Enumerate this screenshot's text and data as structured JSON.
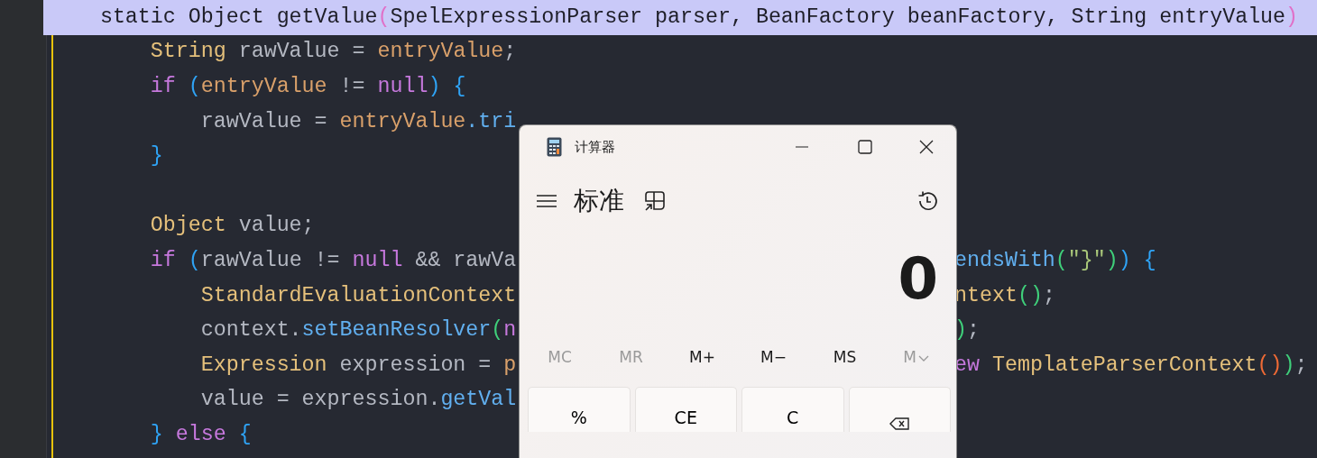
{
  "editor": {
    "signature": {
      "highlighted": true,
      "tokens": [
        {
          "text": "static Object getValue",
          "kind": "plain"
        },
        {
          "text": "(",
          "kind": "paren-pink"
        },
        {
          "text": "SpelExpressionParser parser, BeanFactory beanFactory, String entryValue",
          "kind": "plain"
        },
        {
          "text": ")",
          "kind": "paren-pink"
        }
      ]
    },
    "lines": [
      {
        "kind": "code",
        "highlighted": false,
        "tokens": [
          {
            "text": "String ",
            "kind": "type"
          },
          {
            "text": "rawValue = ",
            "kind": "plain"
          },
          {
            "text": "entryValue",
            "kind": "param"
          },
          {
            "text": ";",
            "kind": "plain"
          }
        ]
      },
      {
        "kind": "code",
        "highlighted": false,
        "tokens": [
          {
            "text": "if ",
            "kind": "keyword"
          },
          {
            "text": "(",
            "kind": "brace-blue"
          },
          {
            "text": "entryValue",
            "kind": "param"
          },
          {
            "text": " != ",
            "kind": "plain"
          },
          {
            "text": "null",
            "kind": "keyword"
          },
          {
            "text": ") {",
            "kind": "brace-blue"
          }
        ],
        "children": [
          {
            "kind": "code",
            "highlighted": false,
            "tokens": [
              {
                "text": "rawValue = ",
                "kind": "plain"
              },
              {
                "text": "entryValue",
                "kind": "param"
              },
              {
                "text": ".tri",
                "kind": "method"
              }
            ]
          }
        ]
      },
      {
        "kind": "code",
        "highlighted": false,
        "tokens": [
          {
            "text": "}",
            "kind": "brace-blue"
          }
        ]
      },
      {
        "kind": "blank"
      },
      {
        "kind": "code",
        "highlighted": false,
        "tokens": [
          {
            "text": "Object ",
            "kind": "type"
          },
          {
            "text": "value;",
            "kind": "plain"
          }
        ]
      },
      {
        "kind": "code",
        "highlighted": false,
        "tokens": [
          {
            "text": "if ",
            "kind": "keyword"
          },
          {
            "text": "(",
            "kind": "brace-blue"
          },
          {
            "text": "rawValue != ",
            "kind": "plain"
          },
          {
            "text": "null",
            "kind": "keyword"
          },
          {
            "text": " && rawVa",
            "kind": "plain"
          }
        ],
        "right_tokens": [
          {
            "text": "endsWith",
            "kind": "method"
          },
          {
            "text": "(",
            "kind": "paren-green"
          },
          {
            "text": "\"}\"",
            "kind": "string"
          },
          {
            "text": ")",
            "kind": "paren-green"
          },
          {
            "text": ") {",
            "kind": "brace-blue"
          }
        ],
        "children": [
          {
            "kind": "code",
            "highlighted": false,
            "tokens": [
              {
                "text": "StandardEvaluationContext",
                "kind": "type"
              }
            ],
            "right_tokens": [
              {
                "text": "ntext",
                "kind": "type"
              },
              {
                "text": "()",
                "kind": "paren-green"
              },
              {
                "text": ";",
                "kind": "plain"
              }
            ]
          },
          {
            "kind": "code",
            "highlighted": false,
            "tokens": [
              {
                "text": "context.",
                "kind": "plain"
              },
              {
                "text": "setBeanResolver",
                "kind": "method"
              },
              {
                "text": "(",
                "kind": "paren-green"
              },
              {
                "text": "n",
                "kind": "keyword"
              }
            ],
            "right_tokens": [
              {
                "text": ")",
                "kind": "paren-green"
              },
              {
                "text": ";",
                "kind": "plain"
              }
            ]
          },
          {
            "kind": "code",
            "highlighted": false,
            "tokens": [
              {
                "text": "Expression ",
                "kind": "type"
              },
              {
                "text": "expression = ",
                "kind": "plain"
              },
              {
                "text": "p",
                "kind": "param"
              }
            ],
            "right_tokens": [
              {
                "text": "ew ",
                "kind": "keyword"
              },
              {
                "text": "TemplateParserContext",
                "kind": "type"
              },
              {
                "text": "()",
                "kind": "paren-orange"
              },
              {
                "text": ")",
                "kind": "paren-green"
              },
              {
                "text": ";",
                "kind": "plain"
              }
            ]
          },
          {
            "kind": "code",
            "highlighted": false,
            "tokens": [
              {
                "text": "value = expression.",
                "kind": "plain"
              },
              {
                "text": "getVal",
                "kind": "method"
              }
            ]
          }
        ]
      },
      {
        "kind": "code",
        "highlighted": false,
        "tokens": [
          {
            "text": "} ",
            "kind": "brace-blue"
          },
          {
            "text": "else ",
            "kind": "keyword"
          },
          {
            "text": "{",
            "kind": "brace-blue"
          }
        ]
      }
    ]
  },
  "calculator": {
    "title": "计算器",
    "mode": "标准",
    "display": "0",
    "memory_buttons": [
      {
        "label": "MC",
        "disabled": true
      },
      {
        "label": "MR",
        "disabled": true
      },
      {
        "label": "M+",
        "disabled": false
      },
      {
        "label": "M−",
        "disabled": false
      },
      {
        "label": "MS",
        "disabled": false
      },
      {
        "label": "M",
        "disabled": true,
        "kind": "dropdown"
      }
    ],
    "keys": [
      {
        "label": "%",
        "kind": "text"
      },
      {
        "label": "CE",
        "kind": "text"
      },
      {
        "label": "C",
        "kind": "text"
      },
      {
        "kind": "backspace"
      }
    ]
  }
}
